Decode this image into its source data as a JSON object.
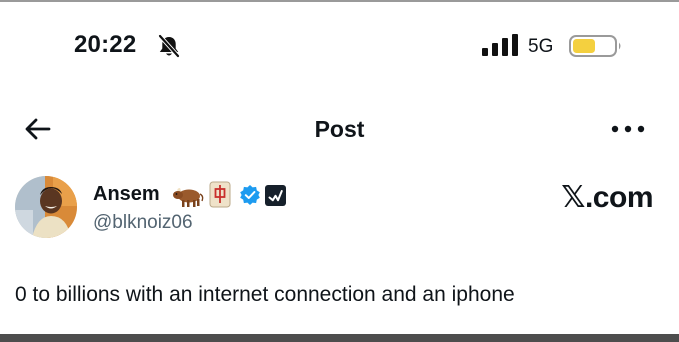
{
  "status_bar": {
    "time": "20:22",
    "network": "5G",
    "icons": [
      "bell-muted-icon",
      "signal-icon",
      "battery-icon"
    ],
    "battery_level": 0.55,
    "battery_color": "#f4d03f"
  },
  "header": {
    "title": "Post",
    "icons": [
      "back-arrow-icon",
      "more-icon"
    ]
  },
  "author": {
    "name": "Ansem",
    "handle": "@blknoiz06",
    "badges": [
      "ox-emoji",
      "mahjong-red-dragon-emoji",
      "verified-badge-icon",
      "affiliate-badge-icon"
    ],
    "verified_color": "#1d9bf0",
    "brand": {
      "symbol": "𝕏",
      "text": ".com"
    }
  },
  "post": {
    "text": "0 to billions with an internet connection and an iphone"
  }
}
